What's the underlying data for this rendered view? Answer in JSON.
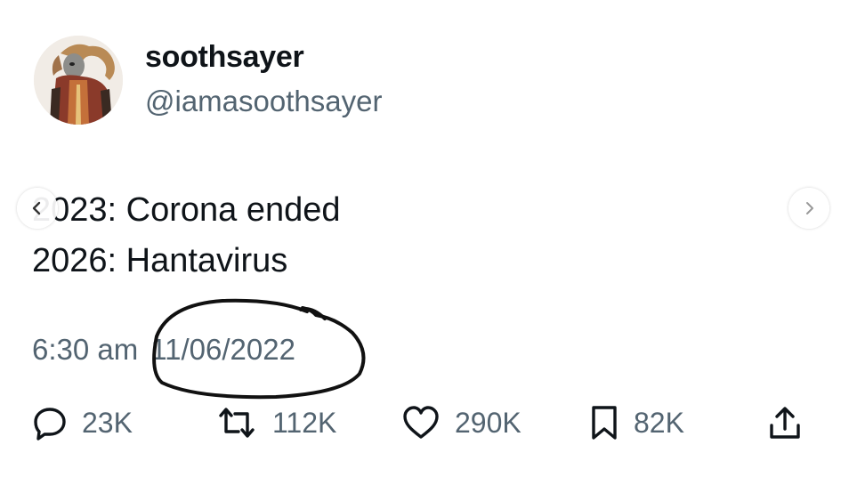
{
  "tweet": {
    "display_name": "soothsayer",
    "handle": "@iamasoothsayer",
    "avatar_icon": "character-avatar",
    "lines": [
      "2023: Corona ended",
      "2026: Hantavirus"
    ],
    "time": "6:30 am",
    "date": "11/06/2022"
  },
  "actions": {
    "reply": {
      "icon": "reply-icon",
      "count": "23K"
    },
    "retweet": {
      "icon": "retweet-icon",
      "count": "112K"
    },
    "like": {
      "icon": "heart-icon",
      "count": "290K"
    },
    "bookmark": {
      "icon": "bookmark-icon",
      "count": "82K"
    },
    "share": {
      "icon": "share-icon"
    }
  },
  "carousel": {
    "prev_icon": "chevron-left-icon",
    "next_icon": "chevron-right-icon"
  },
  "annotation": {
    "color": "#111111"
  },
  "colors": {
    "text": "#0f1419",
    "secondary": "#536471",
    "background": "#ffffff"
  }
}
